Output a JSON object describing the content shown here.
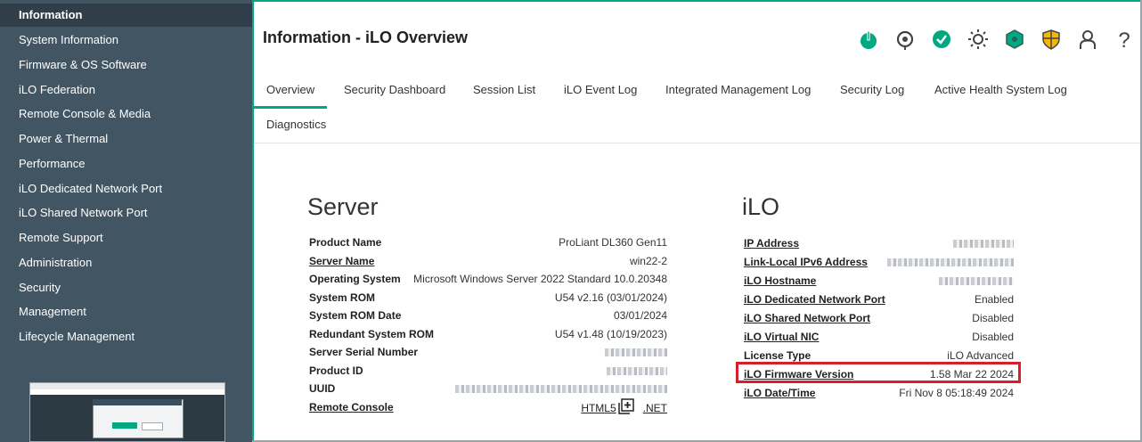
{
  "sidebar": {
    "items": [
      {
        "label": "Information"
      },
      {
        "label": "System Information"
      },
      {
        "label": "Firmware & OS Software"
      },
      {
        "label": "iLO Federation"
      },
      {
        "label": "Remote Console & Media"
      },
      {
        "label": "Power & Thermal"
      },
      {
        "label": "Performance"
      },
      {
        "label": "iLO Dedicated Network Port"
      },
      {
        "label": "iLO Shared Network Port"
      },
      {
        "label": "Remote Support"
      },
      {
        "label": "Administration"
      },
      {
        "label": "Security"
      },
      {
        "label": "Management"
      },
      {
        "label": "Lifecycle Management"
      }
    ]
  },
  "header": {
    "title": "Information - iLO Overview",
    "icons": [
      "power-icon",
      "locate-icon",
      "health-check-icon",
      "uid-light-icon",
      "hexagon-status-icon",
      "security-shield-icon",
      "user-icon",
      "help-icon"
    ],
    "colors": {
      "accent": "#01a982",
      "warning": "#f5b800"
    }
  },
  "tabs": [
    {
      "label": "Overview"
    },
    {
      "label": "Security Dashboard"
    },
    {
      "label": "Session List"
    },
    {
      "label": "iLO Event Log"
    },
    {
      "label": "Integrated Management Log"
    },
    {
      "label": "Security Log"
    },
    {
      "label": "Active Health System Log"
    },
    {
      "label": "Diagnostics"
    }
  ],
  "server": {
    "title": "Server",
    "rows": [
      {
        "label": "Product Name",
        "value": "ProLiant DL360 Gen11"
      },
      {
        "label": "Server Name",
        "value": "win22-2"
      },
      {
        "label": "Operating System",
        "value": "Microsoft Windows Server 2022 Standard 10.0.20348"
      },
      {
        "label": "System ROM",
        "value": "U54 v2.16 (03/01/2024)"
      },
      {
        "label": "System ROM Date",
        "value": "03/01/2024"
      },
      {
        "label": "Redundant System ROM",
        "value": "U54 v1.48 (10/19/2023)"
      },
      {
        "label": "Server Serial Number",
        "value": ""
      },
      {
        "label": "Product ID",
        "value": ""
      },
      {
        "label": "UUID",
        "value": ""
      },
      {
        "label": "Remote Console",
        "value": ""
      }
    ],
    "remote_console": {
      "html5": "HTML5",
      "net": ".NET"
    }
  },
  "ilo": {
    "title": "iLO",
    "rows": [
      {
        "label": "IP Address",
        "value": ""
      },
      {
        "label": "Link-Local IPv6 Address",
        "value": ""
      },
      {
        "label": "iLO Hostname",
        "value": ""
      },
      {
        "label": "iLO Dedicated Network Port",
        "value": "Enabled"
      },
      {
        "label": "iLO Shared Network Port",
        "value": "Disabled"
      },
      {
        "label": "iLO Virtual NIC",
        "value": "Disabled"
      },
      {
        "label": "License Type",
        "value": "iLO Advanced"
      },
      {
        "label": "iLO Firmware Version",
        "value": "1.58 Mar 22 2024"
      },
      {
        "label": "iLO Date/Time",
        "value": "Fri Nov 8 05:18:49 2024"
      }
    ]
  }
}
